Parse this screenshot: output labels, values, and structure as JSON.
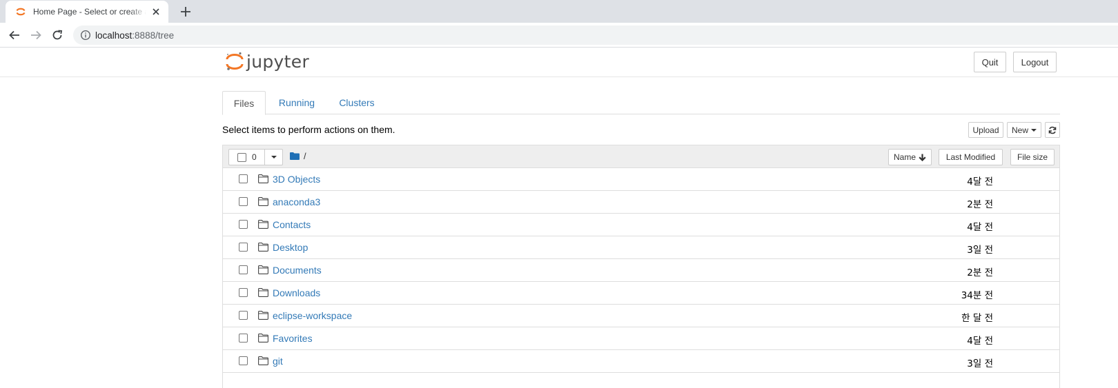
{
  "browser": {
    "tab_title": "Home Page - Select or create a notebook",
    "url_host": "localhost",
    "url_rest": ":8888/tree"
  },
  "header": {
    "logo_text": "jupyter",
    "quit_label": "Quit",
    "logout_label": "Logout"
  },
  "tabs": [
    {
      "label": "Files",
      "active": true
    },
    {
      "label": "Running",
      "active": false
    },
    {
      "label": "Clusters",
      "active": false
    }
  ],
  "toolbar": {
    "hint": "Select items to perform actions on them.",
    "upload_label": "Upload",
    "new_label": "New"
  },
  "list_header": {
    "selected_count": "0",
    "breadcrumb": "/",
    "col_name": "Name",
    "col_modified": "Last Modified",
    "col_size": "File size"
  },
  "files": [
    {
      "name": "3D Objects",
      "modified": "4달 전"
    },
    {
      "name": "anaconda3",
      "modified": "2분 전"
    },
    {
      "name": "Contacts",
      "modified": "4달 전"
    },
    {
      "name": "Desktop",
      "modified": "3일 전"
    },
    {
      "name": "Documents",
      "modified": "2분 전"
    },
    {
      "name": "Downloads",
      "modified": "34분 전"
    },
    {
      "name": "eclipse-workspace",
      "modified": "한 달 전"
    },
    {
      "name": "Favorites",
      "modified": "4달 전"
    },
    {
      "name": "git",
      "modified": "3일 전"
    }
  ],
  "colors": {
    "accent": "#f37726",
    "link": "#337ab7",
    "folder_dark": "#1f6fb5"
  }
}
